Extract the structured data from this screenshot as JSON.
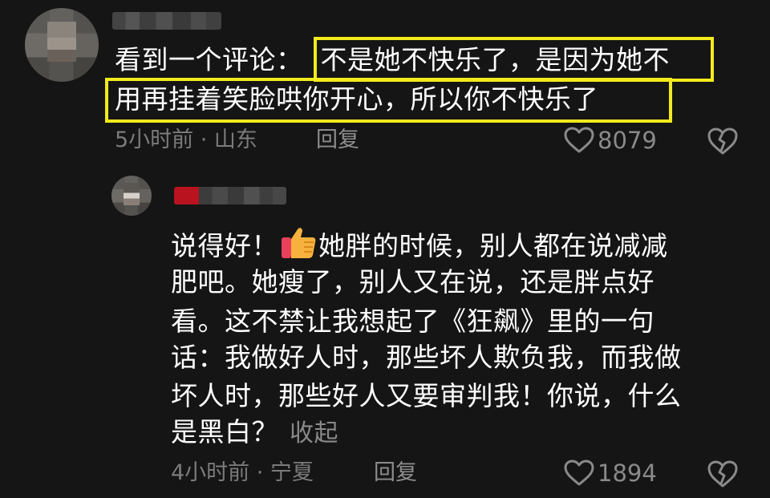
{
  "comment": {
    "prefix": "看到一个评论：",
    "highlight_line1": "不是她不快乐了，是因为她不",
    "highlight_line2": "用再挂着笑脸哄你开心，所以你不快乐了",
    "time_location": "5小时前 · 山东",
    "reply_label": "回复",
    "like_count": "8079"
  },
  "reply": {
    "emoji_icon": "thumbs-up-emoji-icon",
    "lines": [
      "说得好！",
      "她胖的时候，别人都在说减减",
      "肥吧。她瘦了，别人又在说，还是胖点好",
      "看。这不禁让我想起了《狂飙》里的一句",
      "话：我做好人时，那些坏人欺负我，而我做",
      "坏人时，那些好人又要审判我！你说，什么",
      "是黑白？"
    ],
    "collapse_label": "收起",
    "time_location": "4小时前 · 宁夏",
    "reply_label": "回复",
    "like_count": "1894"
  },
  "colors": {
    "background": "#151515",
    "highlight": "#f2ea1d",
    "meta_text": "#7b7b7b"
  }
}
